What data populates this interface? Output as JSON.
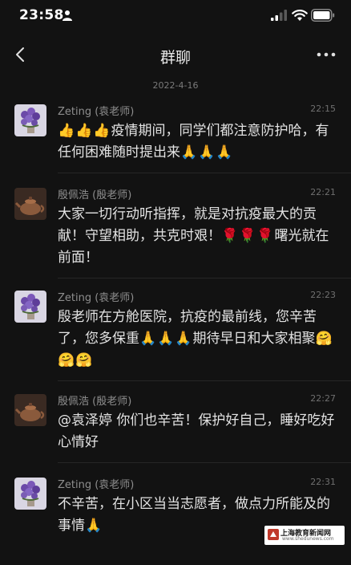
{
  "status_bar": {
    "time": "23:58"
  },
  "nav": {
    "title": "群聊"
  },
  "chat": {
    "date": "2022-4-16",
    "messages": [
      {
        "sender": "Zeting (袁老师)",
        "time": "22:15",
        "avatar": "flower-avatar",
        "segments": [
          {
            "emoji": "👍"
          },
          {
            "emoji": "👍"
          },
          {
            "emoji": "👍"
          },
          {
            "text": "疫情期间，同学们都注意防护哈，有任何困难随时提出来"
          },
          {
            "emoji": "🙏"
          },
          {
            "emoji": "🙏"
          },
          {
            "emoji": "🙏"
          }
        ]
      },
      {
        "sender": "殷佩浩 (殷老师)",
        "time": "22:21",
        "avatar": "teapot-avatar",
        "segments": [
          {
            "text": "大家一切行动听指挥，就是对抗疫最大的贡献！守望相助，共克时艰！"
          },
          {
            "emoji": "🌹"
          },
          {
            "emoji": "🌹"
          },
          {
            "emoji": "🌹"
          },
          {
            "text": "曙光就在前面！"
          }
        ]
      },
      {
        "sender": "Zeting (袁老师)",
        "time": "22:23",
        "avatar": "flower-avatar",
        "segments": [
          {
            "text": "殷老师在方舱医院，抗疫的最前线，您辛苦了，您多保重"
          },
          {
            "emoji": "🙏"
          },
          {
            "emoji": "🙏"
          },
          {
            "emoji": "🙏"
          },
          {
            "text": "期待早日和大家相聚"
          },
          {
            "emoji": "🤗"
          },
          {
            "emoji": "🤗"
          },
          {
            "emoji": "🤗"
          }
        ]
      },
      {
        "sender": "殷佩浩 (殷老师)",
        "time": "22:27",
        "avatar": "teapot-avatar",
        "segments": [
          {
            "text": "@袁泽婷 你们也辛苦！保护好自己，睡好吃好心情好"
          }
        ]
      },
      {
        "sender": "Zeting (袁老师)",
        "time": "22:31",
        "avatar": "flower-avatar",
        "segments": [
          {
            "text": "不辛苦，在小区当当志愿者，做点力所能及的事情"
          },
          {
            "emoji": "🙏"
          }
        ]
      }
    ]
  },
  "watermark": {
    "name": "上海教育新闻网",
    "url": "www.shedunews.com"
  }
}
